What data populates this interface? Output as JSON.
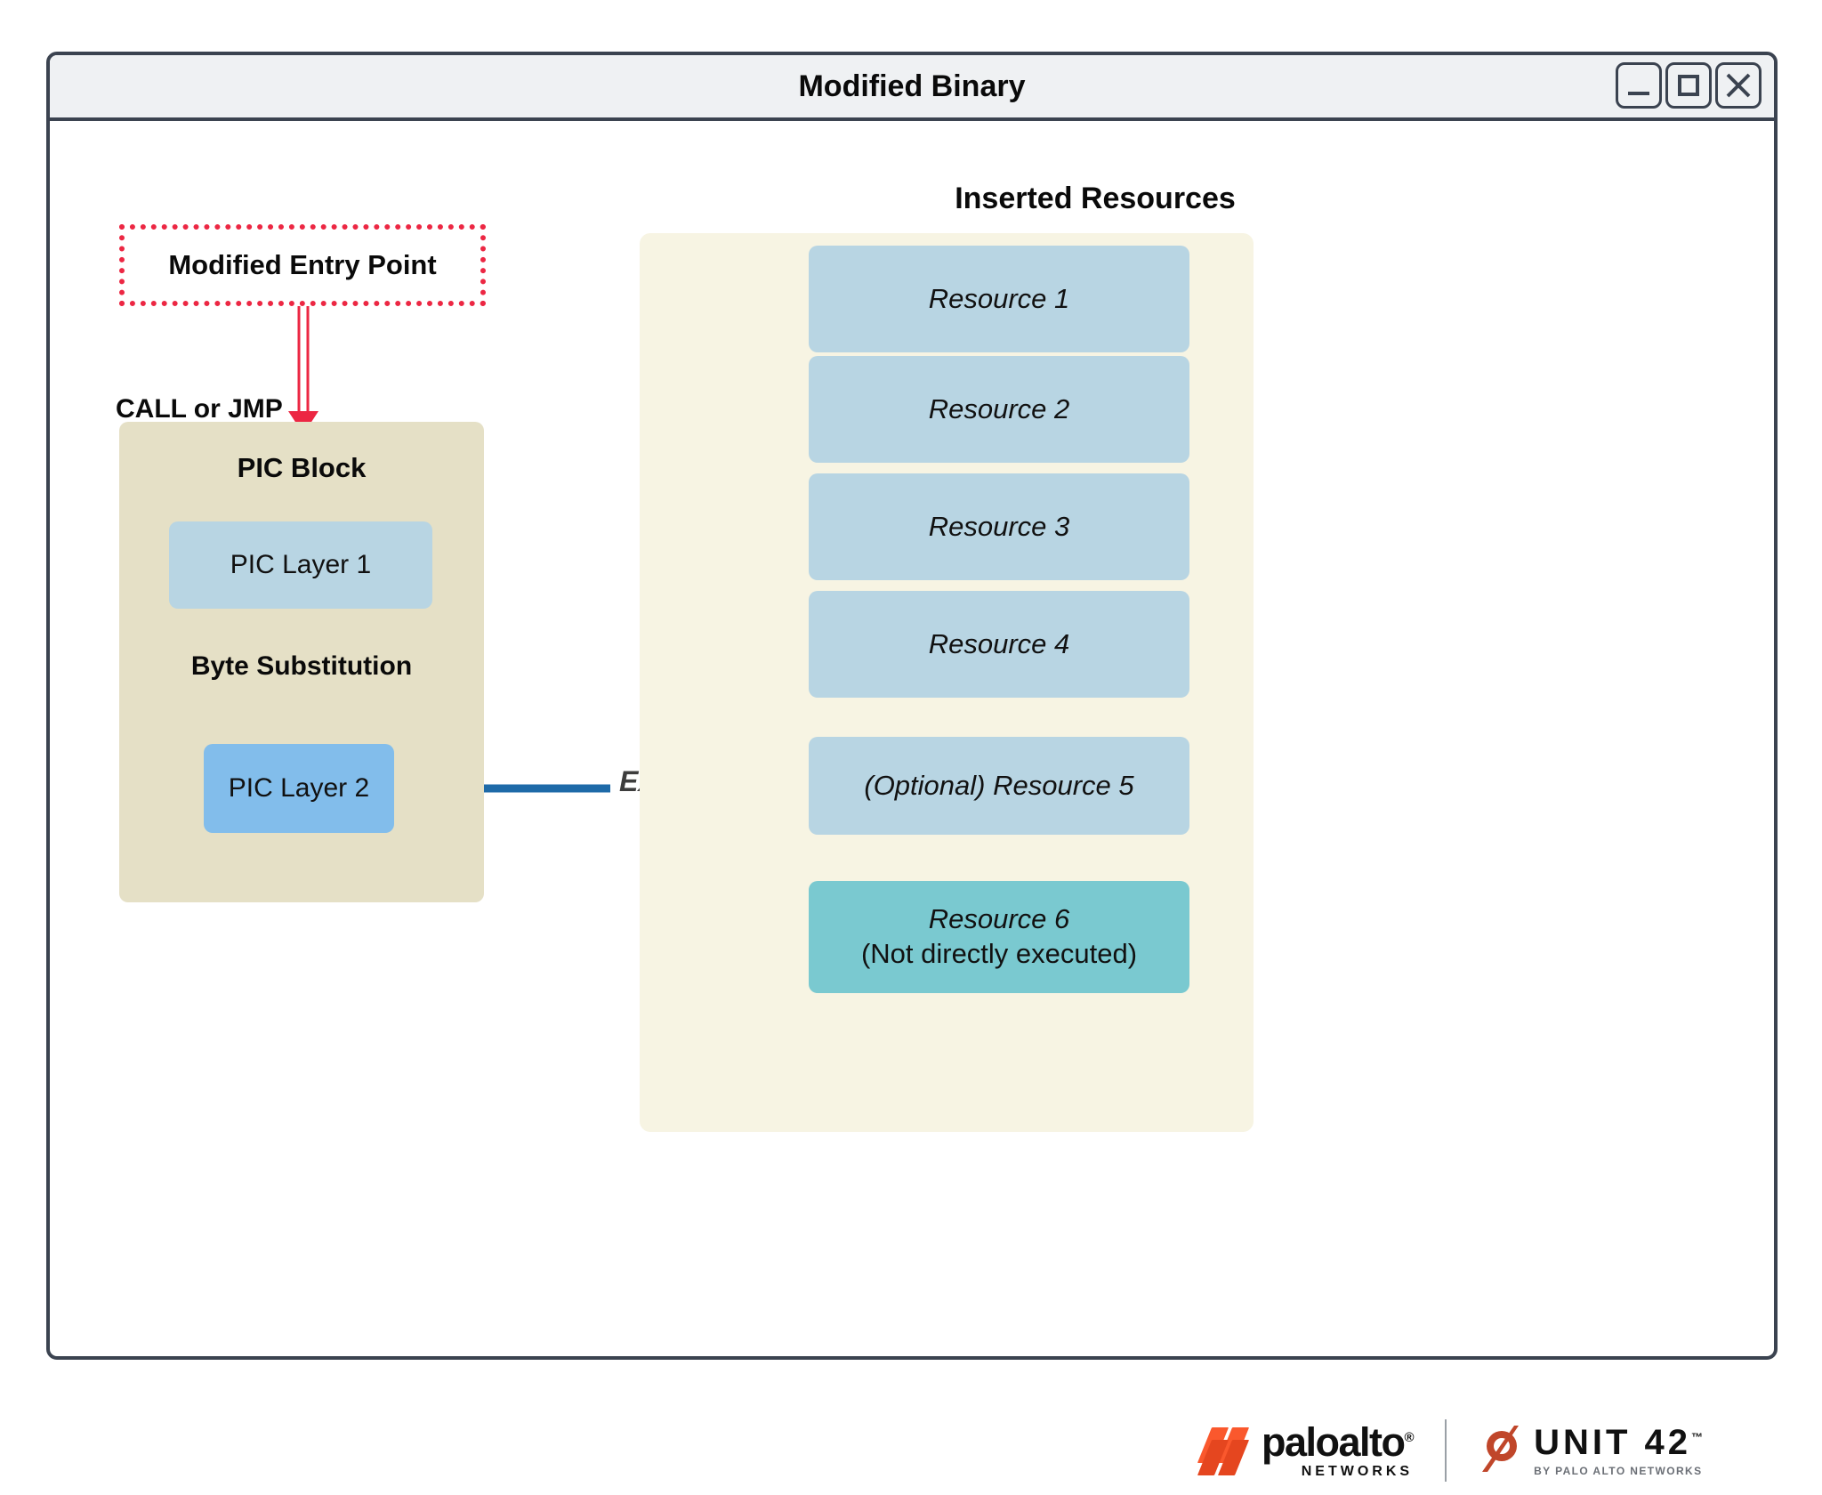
{
  "window": {
    "title": "Modified Binary",
    "controls": [
      {
        "name": "minimize",
        "label": "_"
      },
      {
        "name": "maximize",
        "label": "□"
      },
      {
        "name": "close",
        "label": "✕"
      }
    ]
  },
  "diagram": {
    "entry_point": {
      "label": "Modified Entry Point",
      "border_color": "#ec2743"
    },
    "entry_edge": {
      "label": "CALL or JMP",
      "color": "#ec2743"
    },
    "pic_block": {
      "title": "PIC Block",
      "bg_color": "#e5e0c6",
      "layer1": {
        "label": "PIC Layer 1",
        "color": "#b8d5e3"
      },
      "layer2": {
        "label": "PIC Layer 2",
        "color": "#82bdeb"
      },
      "transform_edge": {
        "label": "Byte Substitution",
        "color": "#77808c"
      }
    },
    "executes_edge": {
      "label": "Executes",
      "color": "#1e6aa8"
    },
    "resources_panel": {
      "title": "Inserted Resources",
      "bg_color": "#f7f4e3",
      "items": [
        {
          "label": "Resource 1",
          "sub_label": "",
          "color": "#b8d5e3",
          "executed": true
        },
        {
          "label": "Resource 2",
          "sub_label": "",
          "color": "#b8d5e3",
          "executed": true
        },
        {
          "label": "Resource 3",
          "sub_label": "",
          "color": "#b8d5e3",
          "executed": true
        },
        {
          "label": "Resource 4",
          "sub_label": "",
          "color": "#b8d5e3",
          "executed": true
        },
        {
          "label": "(Optional) Resource 5",
          "sub_label": "",
          "color": "#b8d5e3",
          "executed": true
        },
        {
          "label": "Resource 6",
          "sub_label": "(Not directly executed)",
          "color": "#7ac9d0",
          "executed": false
        }
      ]
    }
  },
  "footer": {
    "paloalto": {
      "name": "paloalto",
      "registered": "®",
      "sub": "NETWORKS",
      "mark_color": "#fa582d"
    },
    "unit42": {
      "name": "UNIT 42",
      "tm": "™",
      "sub": "BY PALO ALTO NETWORKS",
      "mark_color": "#c0462a"
    }
  }
}
